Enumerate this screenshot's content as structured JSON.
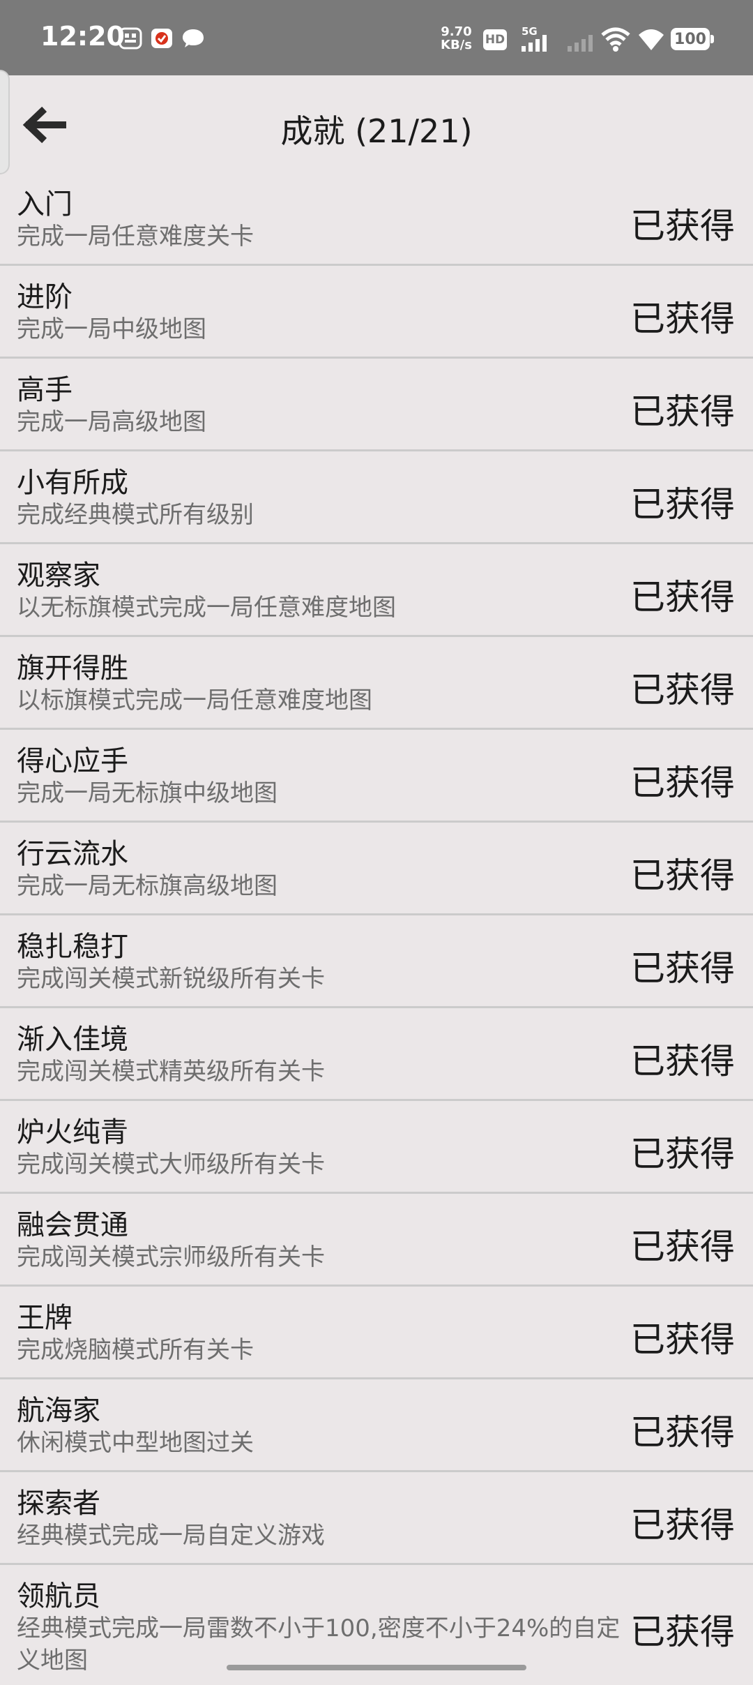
{
  "status_bar": {
    "time": "12:20",
    "net_speed_value": "9.70",
    "net_speed_unit": "KB/s",
    "hd_label": "HD",
    "network_label": "5G",
    "battery": "100"
  },
  "header": {
    "title": "成就 (21/21)"
  },
  "achievements": [
    {
      "name": "入门",
      "desc": "完成一局任意难度关卡",
      "status": "已获得"
    },
    {
      "name": "进阶",
      "desc": "完成一局中级地图",
      "status": "已获得"
    },
    {
      "name": "高手",
      "desc": "完成一局高级地图",
      "status": "已获得"
    },
    {
      "name": "小有所成",
      "desc": "完成经典模式所有级别",
      "status": "已获得"
    },
    {
      "name": "观察家",
      "desc": "以无标旗模式完成一局任意难度地图",
      "status": "已获得"
    },
    {
      "name": "旗开得胜",
      "desc": "以标旗模式完成一局任意难度地图",
      "status": "已获得"
    },
    {
      "name": "得心应手",
      "desc": "完成一局无标旗中级地图",
      "status": "已获得"
    },
    {
      "name": "行云流水",
      "desc": "完成一局无标旗高级地图",
      "status": "已获得"
    },
    {
      "name": "稳扎稳打",
      "desc": "完成闯关模式新锐级所有关卡",
      "status": "已获得"
    },
    {
      "name": "渐入佳境",
      "desc": "完成闯关模式精英级所有关卡",
      "status": "已获得"
    },
    {
      "name": "炉火纯青",
      "desc": "完成闯关模式大师级所有关卡",
      "status": "已获得"
    },
    {
      "name": "融会贯通",
      "desc": "完成闯关模式宗师级所有关卡",
      "status": "已获得"
    },
    {
      "name": "王牌",
      "desc": "完成烧脑模式所有关卡",
      "status": "已获得"
    },
    {
      "name": "航海家",
      "desc": "休闲模式中型地图过关",
      "status": "已获得"
    },
    {
      "name": "探索者",
      "desc": "经典模式完成一局自定义游戏",
      "status": "已获得"
    },
    {
      "name": "领航员",
      "desc": "经典模式完成一局雷数不小于100,密度不小于24%的自定义地图",
      "status": "已获得"
    }
  ]
}
